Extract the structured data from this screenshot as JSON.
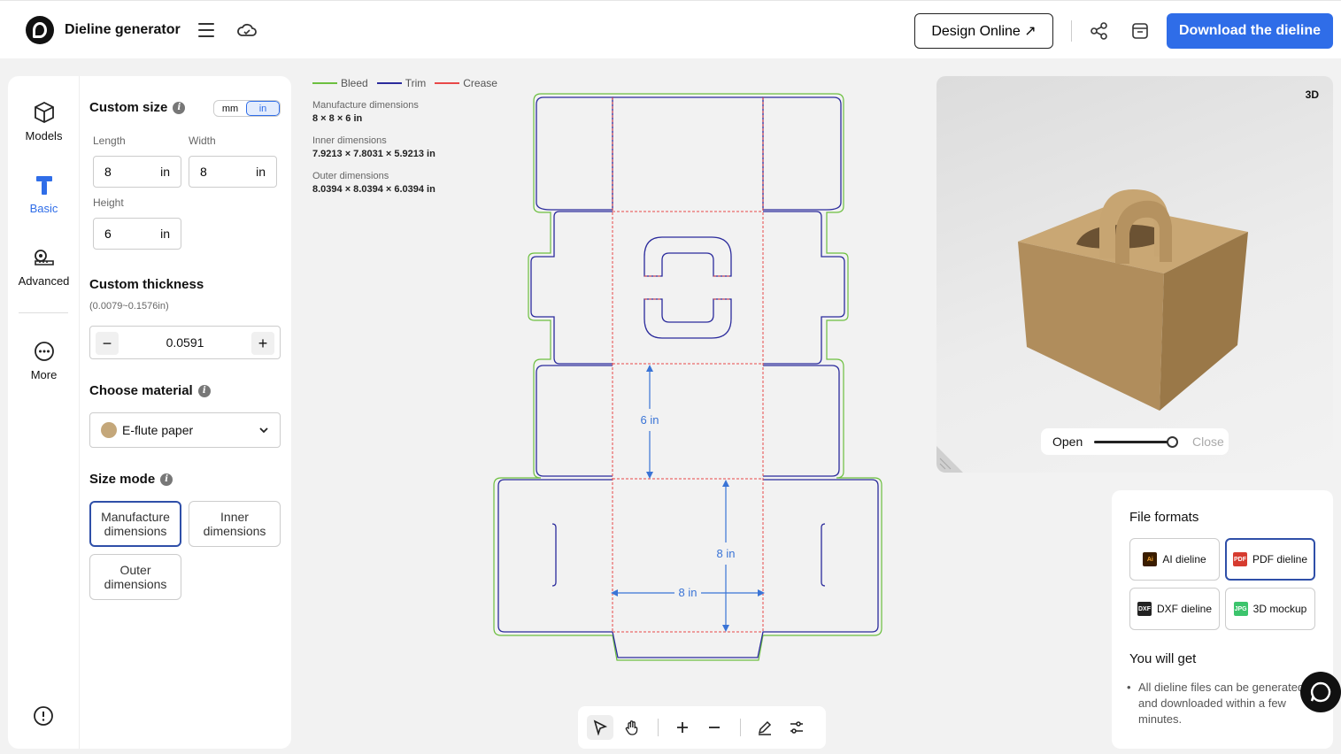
{
  "app": {
    "title": "Dieline generator"
  },
  "header": {
    "design_online": "Design Online ↗",
    "download": "Download the dieline"
  },
  "rail": {
    "items": [
      {
        "label": "Models"
      },
      {
        "label": "Basic"
      },
      {
        "label": "Advanced"
      },
      {
        "label": "More"
      }
    ]
  },
  "custom_size": {
    "title": "Custom size",
    "units": [
      "mm",
      "in"
    ],
    "selected_unit": "in",
    "length": {
      "label": "Length",
      "value": "8",
      "unit": "in"
    },
    "width": {
      "label": "Width",
      "value": "8",
      "unit": "in"
    },
    "height": {
      "label": "Height",
      "value": "6",
      "unit": "in"
    }
  },
  "thickness": {
    "title": "Custom thickness",
    "range": "(0.0079~0.1576in)",
    "value": "0.0591",
    "minus": "−",
    "plus": "+"
  },
  "material": {
    "title": "Choose material",
    "value": "E-flute paper",
    "swatch_color": "#c4a77a"
  },
  "size_mode": {
    "title": "Size mode",
    "options": [
      "Manufacture dimensions",
      "Inner dimensions",
      "Outer dimensions"
    ],
    "selected": "Manufacture dimensions"
  },
  "legend": [
    {
      "label": "Bleed",
      "color": "#6cbf3f"
    },
    {
      "label": "Trim",
      "color": "#2b2b9c"
    },
    {
      "label": "Crease",
      "color": "#e84848"
    }
  ],
  "dimensions": [
    {
      "label": "Manufacture dimensions",
      "value": "8 × 8 × 6 in"
    },
    {
      "label": "Inner dimensions",
      "value": "7.9213 × 7.8031 × 5.9213 in"
    },
    {
      "label": "Outer dimensions",
      "value": "8.0394 × 8.0394 × 6.0394 in"
    }
  ],
  "dieline_labels": {
    "height": "6 in",
    "depth": "8 in",
    "width": "8 in"
  },
  "preview": {
    "mode_label": "3D",
    "open": "Open",
    "close": "Close",
    "open_level": 1.0
  },
  "files": {
    "title": "File formats",
    "formats": [
      {
        "label": "AI dieline",
        "badge": "Ai",
        "color": "#3a1d00",
        "selected": false
      },
      {
        "label": "PDF dieline",
        "badge": "PDF",
        "color": "#d63b2f",
        "selected": true
      },
      {
        "label": "DXF dieline",
        "badge": "DXF",
        "color": "#222222",
        "selected": false
      },
      {
        "label": "3D mockup",
        "badge": "JPG",
        "color": "#3cc46c",
        "selected": false
      }
    ],
    "you_will_get_title": "You will get",
    "you_will_get_text": "All dieline files can be generated and downloaded within a few minutes."
  },
  "colors": {
    "accent": "#2f6de8",
    "selected_border": "#2f4fa8"
  }
}
